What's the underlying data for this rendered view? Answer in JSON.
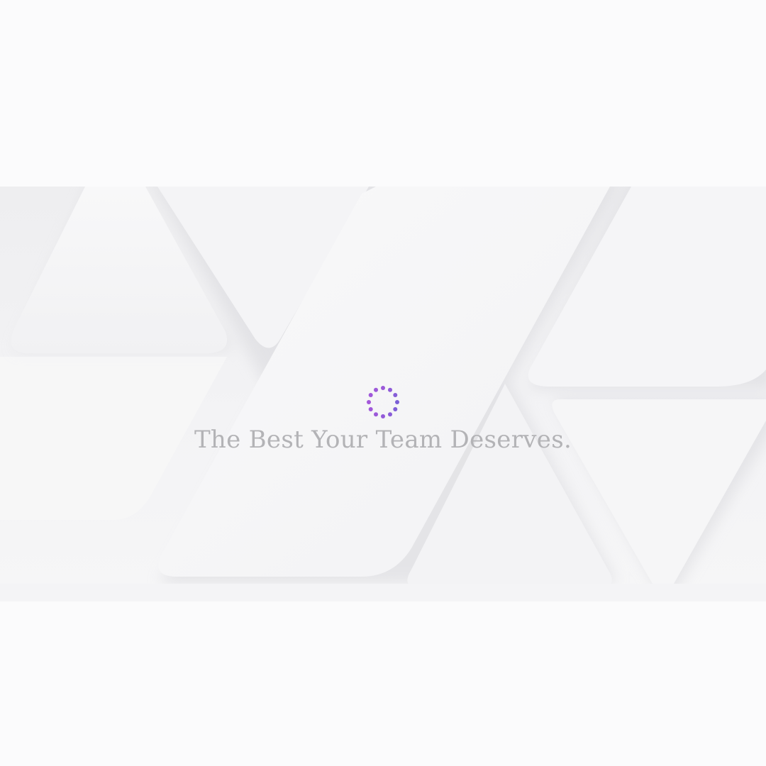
{
  "splash": {
    "tagline": "The Best Your Team Deserves.",
    "accent_color": "#9b59d9",
    "accent_color_alt": "#7a5fd6",
    "background_color": "#fbfbfc",
    "loader_icon": "dotted-spinner-icon"
  }
}
